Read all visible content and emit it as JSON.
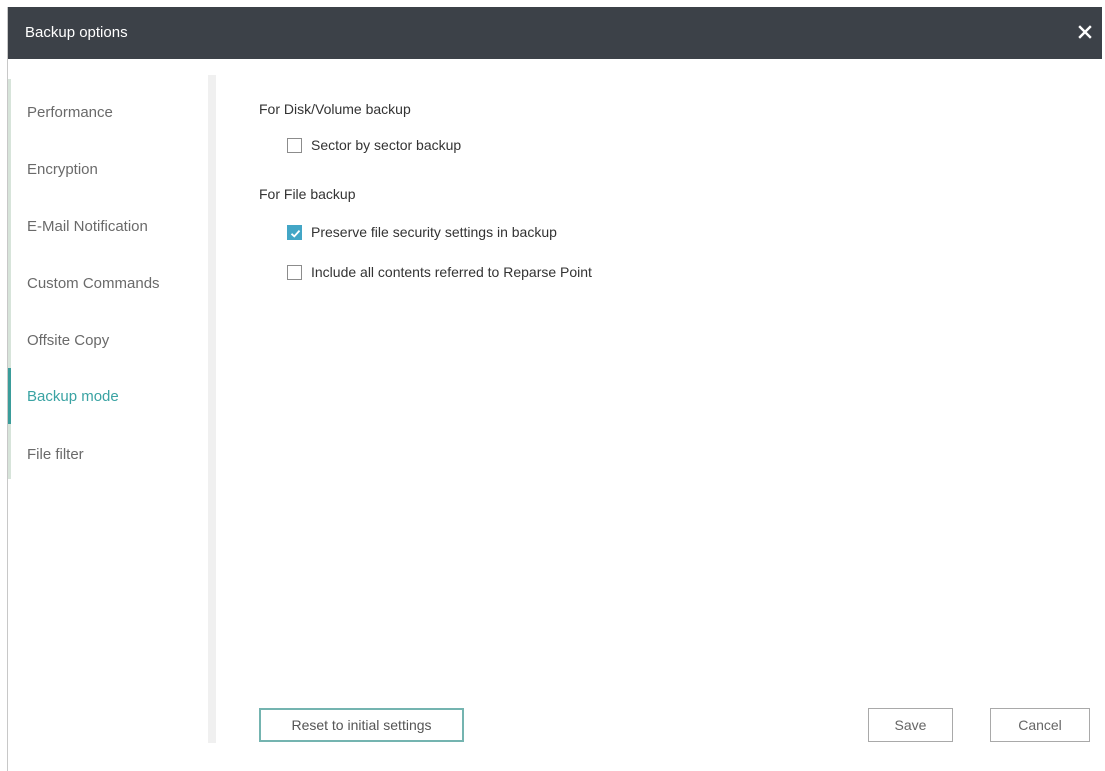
{
  "window": {
    "title": "Backup options",
    "close_icon": "close-icon"
  },
  "sidebar": {
    "items": [
      {
        "label": "Performance",
        "active": false
      },
      {
        "label": "Encryption",
        "active": false
      },
      {
        "label": "E-Mail Notification",
        "active": false
      },
      {
        "label": "Custom Commands",
        "active": false
      },
      {
        "label": "Offsite Copy",
        "active": false
      },
      {
        "label": "Backup mode",
        "active": true
      },
      {
        "label": "File filter",
        "active": false
      }
    ]
  },
  "main": {
    "disk_section": {
      "label": "For Disk/Volume backup",
      "options": [
        {
          "label": "Sector by sector backup",
          "checked": false
        }
      ]
    },
    "file_section": {
      "label": "For File backup",
      "options": [
        {
          "label": "Preserve file security settings in backup",
          "checked": true
        },
        {
          "label": "Include all contents referred to Reparse Point",
          "checked": false
        }
      ]
    }
  },
  "footer": {
    "reset_label": "Reset to initial settings",
    "save_label": "Save",
    "cancel_label": "Cancel"
  },
  "colors": {
    "titlebar": "#3c4148",
    "accent": "#3aa3a3",
    "checkbox_checked": "#43a6c6",
    "reset_border": "#74b4b0"
  }
}
